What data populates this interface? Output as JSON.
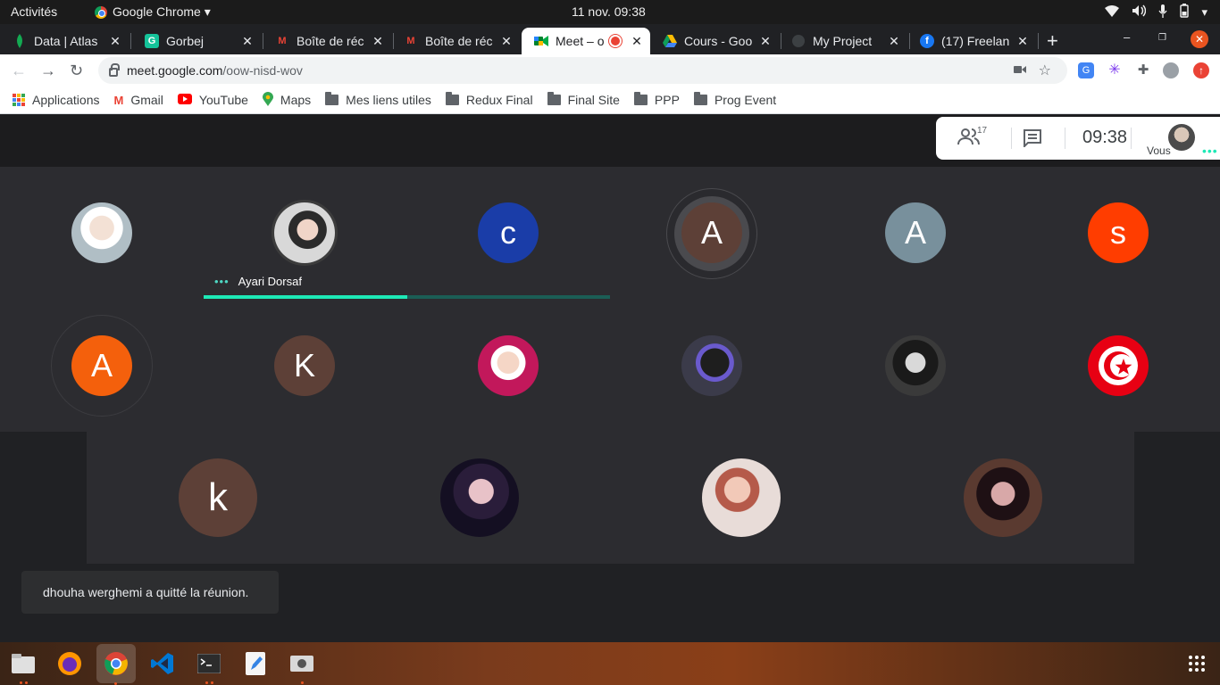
{
  "topbar": {
    "activities": "Activités",
    "app_name": "Google Chrome ▾",
    "clock": "11 nov.  09:38"
  },
  "tabs": [
    {
      "title": "Data | Atlas",
      "icon": "mongodb-leaf-icon",
      "color": "#13aa52"
    },
    {
      "title": "Gorbej",
      "icon": "grammarly-icon",
      "color": "#15c39a"
    },
    {
      "title": "Boîte de réc",
      "icon": "gmail-icon",
      "color": "#ea4335"
    },
    {
      "title": "Boîte de réc",
      "icon": "gmail-icon",
      "color": "#ea4335"
    },
    {
      "title": "Meet – o",
      "icon": "meet-icon",
      "color": "#00832d"
    },
    {
      "title": "Cours - Goo",
      "icon": "google-drive-icon",
      "color": "#fbbc04"
    },
    {
      "title": "My Project",
      "icon": "globe-icon",
      "color": "#5f6368"
    },
    {
      "title": "(17) Freelan",
      "icon": "facebook-icon",
      "color": "#1877f2"
    }
  ],
  "address": {
    "host": "meet.google.com",
    "path": "/oow-nisd-wov"
  },
  "bookmarks": [
    {
      "label": "Applications",
      "type": "apps"
    },
    {
      "label": "Gmail",
      "type": "gmail"
    },
    {
      "label": "YouTube",
      "type": "youtube"
    },
    {
      "label": "Maps",
      "type": "maps"
    },
    {
      "label": "Mes liens utiles",
      "type": "folder"
    },
    {
      "label": "Redux Final",
      "type": "folder"
    },
    {
      "label": "Final Site",
      "type": "folder"
    },
    {
      "label": "PPP",
      "type": "folder"
    },
    {
      "label": "Prog Event",
      "type": "folder"
    }
  ],
  "meet": {
    "participant_count": "17",
    "time": "09:38",
    "self_label": "Vous",
    "speaker_name": "Ayari Dorsaf",
    "speaker_level": 0.5,
    "toast": "dhouha werghemi a quitté la réunion."
  },
  "participants": [
    {
      "letter": "",
      "bg": "#c9d4dc",
      "kind": "photo"
    },
    {
      "letter": "",
      "bg": "#6b4a4a",
      "kind": "photo"
    },
    {
      "letter": "c",
      "bg": "#1a3da8",
      "kind": "letter"
    },
    {
      "letter": "A",
      "bg": "#5d4037",
      "kind": "letter"
    },
    {
      "letter": "A",
      "bg": "#78909c",
      "kind": "letter"
    },
    {
      "letter": "s",
      "bg": "#ff3d00",
      "kind": "letter"
    },
    {
      "letter": "A",
      "bg": "#f4600c",
      "kind": "letter"
    },
    {
      "letter": "K",
      "bg": "#5d4037",
      "kind": "letter"
    },
    {
      "letter": "",
      "bg": "#c2185b",
      "kind": "photo"
    },
    {
      "letter": "",
      "bg": "#3b3b4a",
      "kind": "photo"
    },
    {
      "letter": "",
      "bg": "#2e2e2e",
      "kind": "photo"
    },
    {
      "letter": "",
      "bg": "#e53935",
      "kind": "flag"
    },
    {
      "letter": "k",
      "bg": "#5d4037",
      "kind": "letter"
    },
    {
      "letter": "",
      "bg": "#2a2140",
      "kind": "photo"
    },
    {
      "letter": "",
      "bg": "#c48b8b",
      "kind": "photo"
    },
    {
      "letter": "",
      "bg": "#3a2430",
      "kind": "photo"
    }
  ]
}
